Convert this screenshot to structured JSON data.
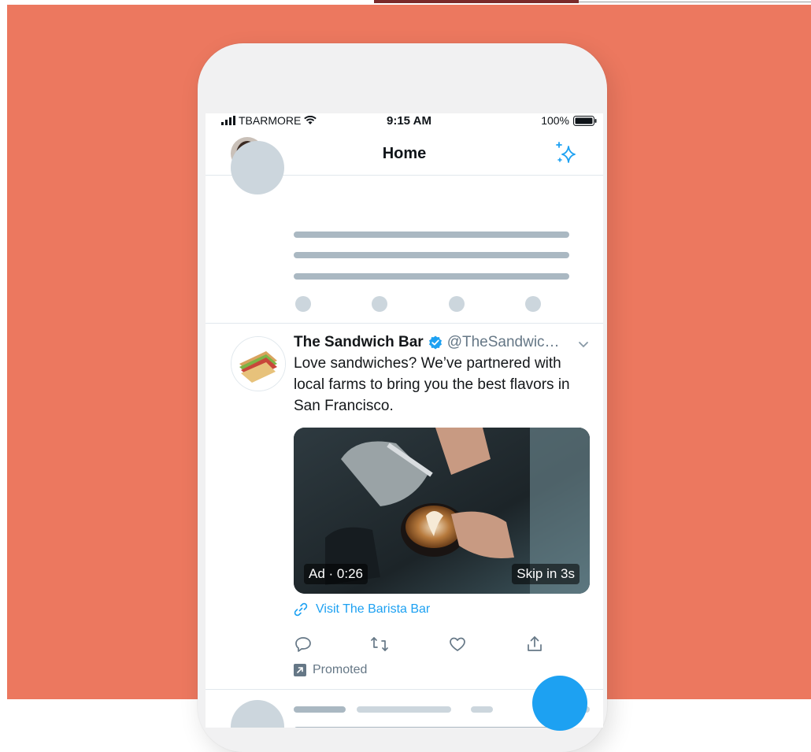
{
  "status_bar": {
    "carrier": "TBARMORE",
    "time": "9:15 AM",
    "battery": "100%"
  },
  "nav": {
    "title": "Home"
  },
  "ad_tweet": {
    "name": "The Sandwich Bar",
    "handle": "@TheSandwic…",
    "text": "Love sandwiches? We’ve partnered with local farms to bring you the best flavors in San Francisco.",
    "media": {
      "ad_label": "Ad · 0:26",
      "skip_label": "Skip in 3s"
    },
    "link_text": "Visit The Barista Bar",
    "promoted_label": "Promoted"
  },
  "icons": [
    "signal-icon",
    "wifi-icon",
    "battery-icon",
    "sparkle-icon",
    "verified-icon",
    "chevron-down-icon",
    "link-icon",
    "reply-icon",
    "retweet-icon",
    "like-icon",
    "share-icon",
    "promoted-icon"
  ],
  "colors": {
    "background": "#ec785f",
    "accent": "#1da1f2",
    "skeleton": "#ccd6dd"
  }
}
